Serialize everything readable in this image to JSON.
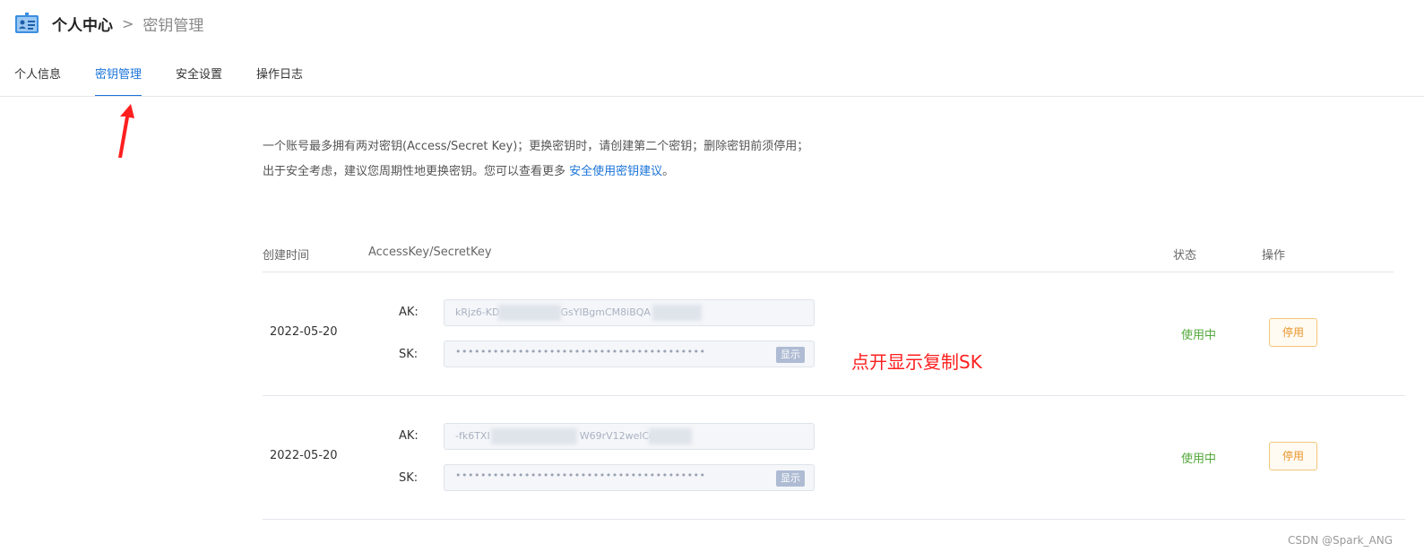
{
  "header": {
    "title": "个人中心",
    "separator": ">",
    "subtitle": "密钥管理"
  },
  "tabs": [
    {
      "label": "个人信息",
      "active": false
    },
    {
      "label": "密钥管理",
      "active": true
    },
    {
      "label": "安全设置",
      "active": false
    },
    {
      "label": "操作日志",
      "active": false
    }
  ],
  "notice": {
    "text": "一个账号最多拥有两对密钥(Access/Secret Key)；更换密钥时，请创建第二个密钥；删除密钥前须停用；出于安全考虑，建议您周期性地更换密钥。您可以查看更多 ",
    "link": "安全使用密钥建议",
    "suffix": "。"
  },
  "table": {
    "headers": {
      "created": "创建时间",
      "keys": "AccessKey/SecretKey",
      "status": "状态",
      "action": "操作"
    },
    "ak_label": "AK:",
    "sk_label": "SK:",
    "show_label": "显示",
    "rows": [
      {
        "date": "2022-05-20",
        "ak_part1": "kRjz6-KD",
        "ak_part2": "GsYIBgmCM8iBQA",
        "sk_mask": "••••••••••••••••••••••••••••••••••••••••",
        "status": "使用中",
        "action": "停用"
      },
      {
        "date": "2022-05-20",
        "ak_part1": "-fk6TXI",
        "ak_part2": "W69rV12welCg",
        "sk_mask": "••••••••••••••••••••••••••••••••••••••••",
        "status": "使用中",
        "action": "停用"
      }
    ]
  },
  "annotation": "点开显示复制SK",
  "watermark": "CSDN @Spark_ANG",
  "colors": {
    "accent": "#1a73d9",
    "status_ok": "#52a83a",
    "warning": "#e8962a",
    "annotation": "#ff1f1f"
  }
}
